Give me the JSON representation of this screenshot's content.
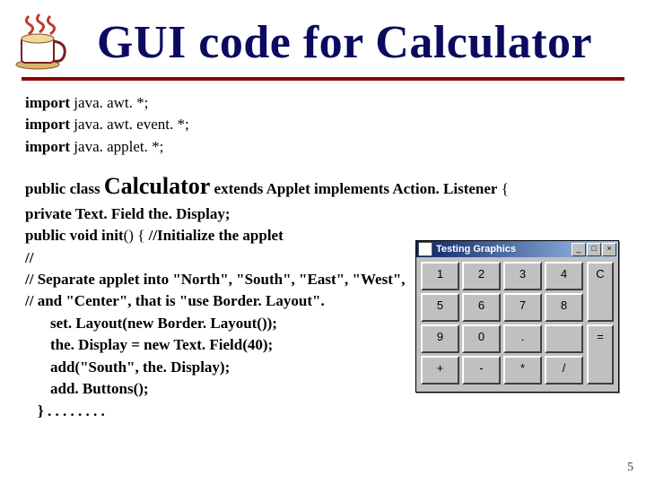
{
  "title": "GUI code for Calculator",
  "imports": [
    {
      "kw": "import",
      "rest": " java. awt. *;"
    },
    {
      "kw": "import",
      "rest": " java. awt. event. *;"
    },
    {
      "kw": "import",
      "rest": " java. applet. *;"
    }
  ],
  "class_decl": {
    "pub_class": "public class ",
    "name": "Calculator",
    "extends_kw": " extends ",
    "extends_name": "Applet",
    "impl_kw": " implements ",
    "impl_name": "Action. Listener",
    "open": " {"
  },
  "field": {
    "kw": "private",
    "rest": " Text. Field the. Display;"
  },
  "init_sig": {
    "kw": "public void ",
    "name": "init",
    "args": "() {",
    "cmt": "    //Initialize the applet"
  },
  "cmts": [
    "//",
    "//  Separate applet into \"North\", \"South\", \"East\", \"West\",",
    "//  and \"Center\", that is \"use Border. Layout\"."
  ],
  "stmt1": {
    "pre": "set. Layout(",
    "kw": "new",
    "post": " Border. Layout());"
  },
  "stmt2": {
    "pre": "the. Display = ",
    "kw": "new",
    "post": " Text. Field(40);"
  },
  "stmt3": "add(\"South\", the. Display);",
  "stmt4": "add. Buttons();",
  "close": "}    . . . . . . . .",
  "page_num": "5",
  "calc": {
    "title": "Testing Graphics",
    "min": "_",
    "max": "□",
    "close": "×",
    "rows": [
      [
        "1",
        "2",
        "3",
        "4"
      ],
      [
        "5",
        "6",
        "7",
        "8"
      ],
      [
        "9",
        "0",
        ".",
        ""
      ],
      [
        "+",
        "-",
        "*",
        "/"
      ]
    ],
    "side": {
      "c": "C",
      "eq": "="
    }
  }
}
